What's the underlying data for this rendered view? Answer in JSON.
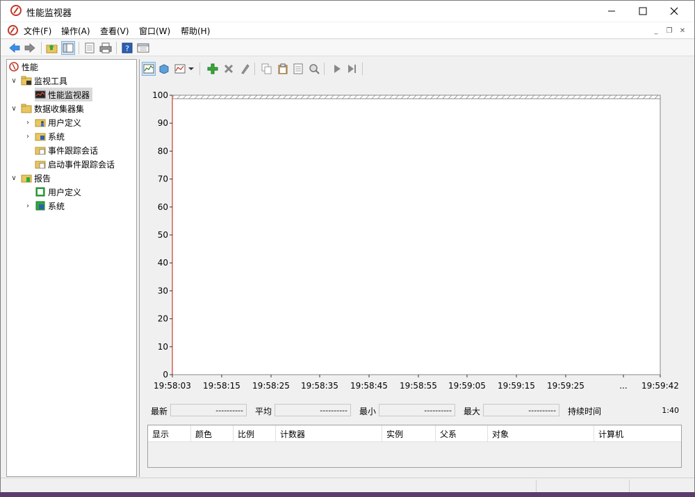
{
  "window": {
    "title": "性能监视器"
  },
  "menubar": {
    "items": [
      "文件(F)",
      "操作(A)",
      "查看(V)",
      "窗口(W)",
      "帮助(H)"
    ]
  },
  "toolbar": {
    "icons": [
      "back-icon",
      "forward-icon",
      "up-folder-icon",
      "show-hide-tree-icon",
      "properties-icon",
      "print-icon",
      "help-icon",
      "show-hide-action-icon"
    ]
  },
  "tree": {
    "root": "性能",
    "monitoring_tools": "监视工具",
    "perf_monitor": "性能监视器",
    "data_collector_sets": "数据收集器集",
    "user_defined": "用户定义",
    "system": "系统",
    "event_trace_sessions": "事件跟踪会话",
    "startup_event_trace_sessions": "启动事件跟踪会话",
    "reports": "报告",
    "reports_user_defined": "用户定义",
    "reports_system": "系统"
  },
  "perf_toolbar": {
    "icons": [
      "view-current-activity-icon",
      "view-log-data-icon",
      "change-graph-type-icon",
      "dropdown-icon",
      "add-icon",
      "delete-icon",
      "highlight-icon",
      "copy-properties-icon",
      "paste-counter-list-icon",
      "properties-icon",
      "zoom-icon",
      "freeze-display-icon",
      "update-data-icon"
    ]
  },
  "chart_data": {
    "type": "line",
    "ylim": [
      0,
      100
    ],
    "yticks": [
      "0",
      "10",
      "20",
      "30",
      "40",
      "50",
      "60",
      "70",
      "80",
      "90",
      "100"
    ],
    "xticks": [
      "19:58:03",
      "19:58:15",
      "19:58:25",
      "19:58:35",
      "19:58:45",
      "19:58:55",
      "19:59:05",
      "19:59:15",
      "19:59:25",
      "...",
      "19:59:42"
    ],
    "series": []
  },
  "stats": {
    "last_label": "最新",
    "last_value": "----------",
    "avg_label": "平均",
    "avg_value": "----------",
    "min_label": "最小",
    "min_value": "----------",
    "max_label": "最大",
    "max_value": "----------",
    "duration_label": "持续时间",
    "duration_value": "1:40"
  },
  "legend": {
    "columns": [
      "显示",
      "颜色",
      "比例",
      "计数器",
      "实例",
      "父系",
      "对象",
      "计算机"
    ]
  }
}
